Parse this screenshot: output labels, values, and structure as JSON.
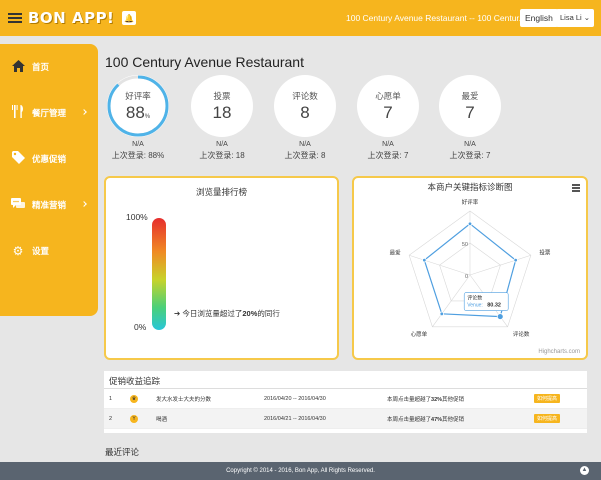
{
  "topbar": {
    "logo": "BON APP!",
    "restaurant_select": "100 Century Avenue Restaurant -- 100 Centur...",
    "lang_button": "English",
    "user_button": "Lisa Li"
  },
  "sidebar": {
    "items": [
      {
        "label": "首页",
        "icon": "home-icon"
      },
      {
        "label": "餐厅管理",
        "icon": "cutlery-icon"
      },
      {
        "label": "优惠促销",
        "icon": "tag-icon"
      },
      {
        "label": "精准营销",
        "icon": "chat-icon"
      },
      {
        "label": "设置",
        "icon": "gear-icon"
      }
    ]
  },
  "page_title": "100 Century Avenue Restaurant",
  "stats": [
    {
      "label": "好评率",
      "value": "88",
      "unit": "%",
      "na": "N/A",
      "last": "上次登录: 88%",
      "progress": 0.88
    },
    {
      "label": "投票",
      "value": "18",
      "na": "N/A",
      "last": "上次登录: 18"
    },
    {
      "label": "评论数",
      "value": "8",
      "na": "N/A",
      "last": "上次登录: 8"
    },
    {
      "label": "心愿单",
      "value": "7",
      "na": "N/A",
      "last": "上次登录: 7"
    },
    {
      "label": "最爱",
      "value": "7",
      "na": "N/A",
      "last": "上次登录: 7"
    }
  ],
  "traffic_card": {
    "title": "浏览量排行榜",
    "top_label": "100%",
    "bottom_label": "0%",
    "note_prefix": "今日浏览量超过了",
    "note_value": "20%",
    "note_suffix": "的同行",
    "level": 0.2
  },
  "radar_card": {
    "title": "本商户关键指标诊断图",
    "credit": "Highcharts.com",
    "tooltip_name": "评论数",
    "tooltip_series": "Venue:",
    "tooltip_value": "80.32"
  },
  "chart_data": {
    "type": "radar",
    "title": "本商户关键指标诊断图",
    "categories": [
      "好评率",
      "投票",
      "评论数",
      "心愿单",
      "最爱"
    ],
    "tick_labels": [
      "0",
      "50"
    ],
    "ylim": [
      0,
      100
    ],
    "series": [
      {
        "name": "Venue",
        "values": [
          80,
          75,
          80.32,
          75,
          75
        ]
      }
    ]
  },
  "promo": {
    "title": "促销收益追踪",
    "rows": [
      {
        "rank": "1",
        "name": "发大水发士大夫的分数",
        "dates": "2016/04/20 -- 2016/04/30",
        "note_prefix": "本周点击量超越了",
        "note_value": "32%",
        "note_suffix": "其他促销",
        "button": "如何提高"
      },
      {
        "rank": "2",
        "name": "喝酒",
        "dates": "2016/04/21 -- 2016/04/30",
        "note_prefix": "本周点击量超越了",
        "note_value": "47%",
        "note_suffix": "其他促销",
        "button": "如何提高"
      }
    ]
  },
  "recent_reviews": "最近评论",
  "footer": "Copyright © 2014 - 2016, Bon App, All Rights Reserved.",
  "colors": {
    "accent": "#f6b51e",
    "ring": "#4fb3e8",
    "footer": "#5a6470"
  }
}
